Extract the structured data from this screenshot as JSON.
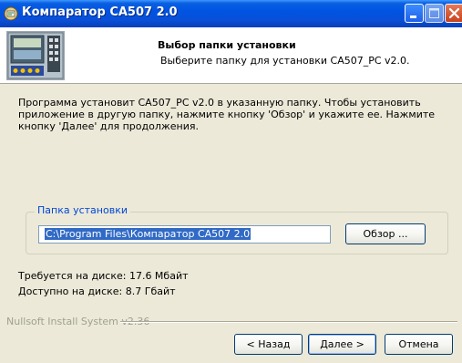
{
  "window": {
    "title": "Компаратор CA507 2.0",
    "title_bar_color": "#0a4fd6"
  },
  "header": {
    "title": "Выбор папки установки",
    "subtitle": "Выберите папку для установки CA507_PC v2.0."
  },
  "body": {
    "description": "Программа установит CA507_PC v2.0 в указанную папку. Чтобы установить приложение в другую папку, нажмите кнопку 'Обзор' и укажите ее. Нажмите кнопку 'Далее' для продолжения."
  },
  "install_folder": {
    "group_label": "Папка установки",
    "path_value": "C:\\Program Files\\Компаратор CA507 2.0",
    "browse_label": "Обзор ..."
  },
  "disk": {
    "required": "Требуется на диске: 17.6 Мбайт",
    "available": "Доступно на диске: 8.7 Гбайт"
  },
  "footer": {
    "branding": "Nullsoft Install System v2.36",
    "back_label": "< Назад",
    "next_label": "Далее >",
    "cancel_label": "Отмена"
  },
  "icons": [
    "installer-icon",
    "minimize-icon",
    "maximize-icon",
    "close-icon",
    "device-image"
  ]
}
